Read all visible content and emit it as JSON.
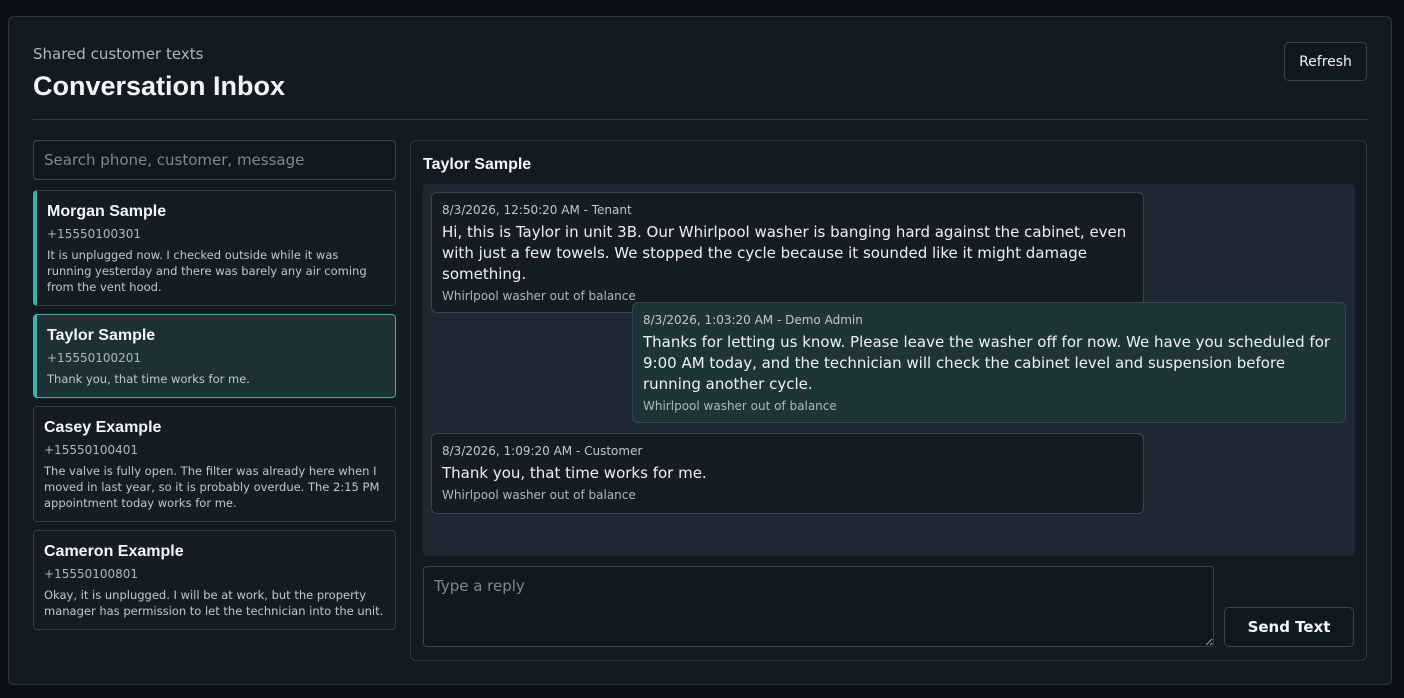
{
  "header": {
    "eyebrow": "Shared customer texts",
    "title": "Conversation Inbox",
    "refresh_label": "Refresh"
  },
  "search": {
    "placeholder": "Search phone, customer, message",
    "value": ""
  },
  "conversations": [
    {
      "name": "Morgan Sample",
      "phone": "+15550100301",
      "preview": "It is unplugged now. I checked outside while it was running yesterday and there was barely any air coming from the vent hood."
    },
    {
      "name": "Taylor Sample",
      "phone": "+15550100201",
      "preview": "Thank you, that time works for me."
    },
    {
      "name": "Casey Example",
      "phone": "+15550100401",
      "preview": "The valve is fully open. The filter was already here when I moved in last year, so it is probably overdue. The 2:15 PM appointment today works for me."
    },
    {
      "name": "Cameron Example",
      "phone": "+15550100801",
      "preview": "Okay, it is unplugged. I will be at work, but the property manager has permission to let the technician into the unit."
    }
  ],
  "thread": {
    "title": "Taylor Sample",
    "messages": [
      {
        "meta": "8/3/2026, 12:50:20 AM - Tenant",
        "body": "Hi, this is Taylor in unit 3B. Our Whirlpool washer is banging hard against the cabinet, even with just a few towels. We stopped the cycle because it sounded like it might damage something.",
        "topic": "Whirlpool washer out of balance"
      },
      {
        "meta": "8/3/2026, 1:03:20 AM - Demo Admin",
        "body": "Thanks for letting us know. Please leave the washer off for now. We have you scheduled for 9:00 AM today, and the technician will check the cabinet level and suspension before running another cycle.",
        "topic": "Whirlpool washer out of balance"
      },
      {
        "meta": "8/3/2026, 1:09:20 AM - Customer",
        "body": "Thank you, that time works for me.",
        "topic": "Whirlpool washer out of balance"
      }
    ]
  },
  "composer": {
    "placeholder": "Type a reply",
    "value": "",
    "send_label": "Send Text"
  },
  "colors": {
    "accent": "#3fb3a4",
    "background": "#0b1017",
    "panel": "#131a23"
  }
}
